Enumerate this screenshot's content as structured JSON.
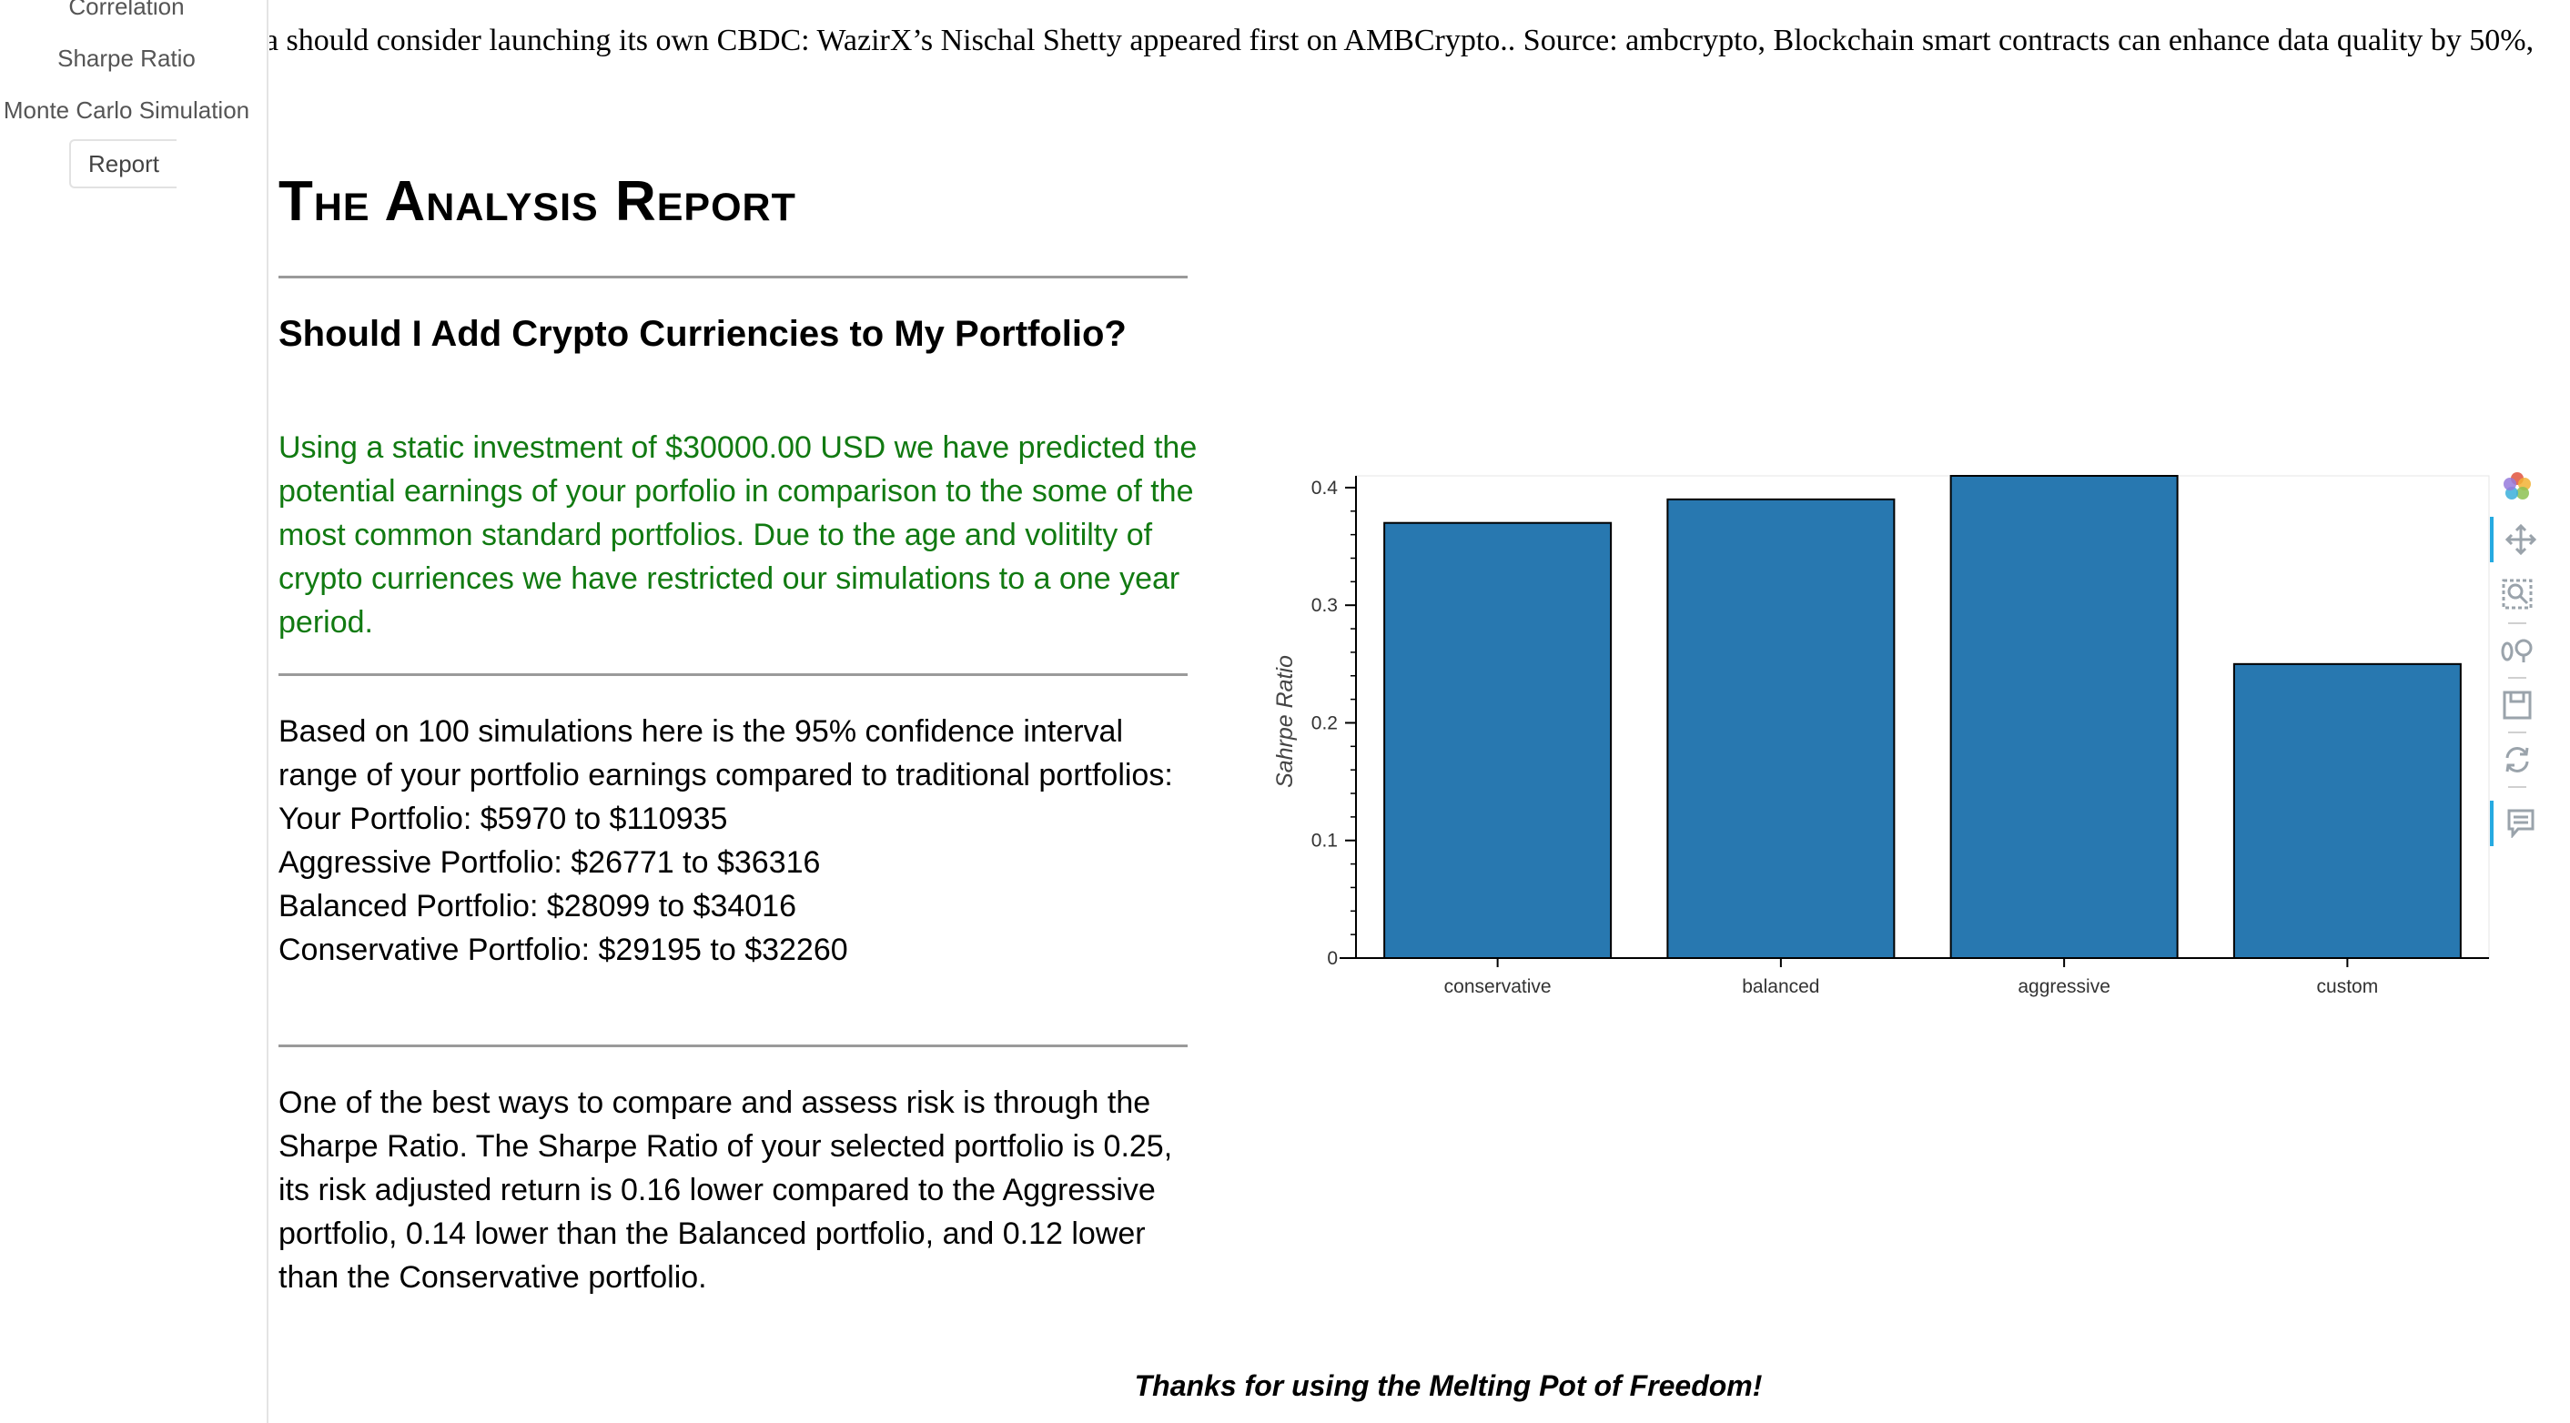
{
  "sidebar": {
    "items": [
      {
        "label": "Correlation"
      },
      {
        "label": "Sharpe Ratio"
      },
      {
        "label": "Monte Carlo Simulation"
      },
      {
        "label": "Report"
      }
    ]
  },
  "ticker": {
    "text": "lia should consider launching its own CBDC: WazirX’s Nischal Shetty appeared first on AMBCrypto.. Source: ambcrypto,  Blockchain smart contracts can enhance data quality by 50%,"
  },
  "report": {
    "title": "The Analysis Report",
    "subtitle": "Should I Add Crypto Curriencies to My Portfolio?",
    "intro": "Using a static investment of $30000.00 USD we have predicted the potential earnings of your porfolio in comparison to the some of the most common standard portfolios. Due to the age and volitilty of crypto curriences we have restricted our simulations to a one year period.",
    "ci_intro": "Based on 100 simulations here is the 95% confidence interval range of your portfolio earnings compared to traditional portfolios:",
    "ci_lines": [
      "Your Portfolio: $5970 to $110935",
      "Aggressive Portfolio: $26771 to $36316",
      "Balanced Portfolio: $28099 to $34016",
      "Conservative Portfolio: $29195 to $32260"
    ],
    "sharpe_text": "One of the best ways to compare and assess risk is through the Sharpe Ratio. The Sharpe Ratio of your selected portfolio is 0.25, its risk adjusted return is 0.16 lower compared to the Aggressive portfolio, 0.14 lower than the Balanced portfolio, and 0.12 lower than the Conservative portfolio.",
    "thanks": "Thanks for using the Melting Pot of Freedom!",
    "intro_color": "#117a11"
  },
  "chart_data": {
    "type": "bar",
    "categories": [
      "conservative",
      "balanced",
      "aggressive",
      "custom"
    ],
    "values": [
      0.37,
      0.39,
      0.41,
      0.25
    ],
    "ylabel": "Sahrpe Ratio",
    "xlabel": "",
    "ylim": [
      0,
      0.41
    ],
    "yticks": [
      "0",
      "0.1",
      "0.2",
      "0.3",
      "0.4"
    ],
    "bar_color": "#2878b0",
    "grid": false
  },
  "toolbar": {
    "tools": [
      {
        "icon": "bokeh-logo-icon"
      },
      {
        "icon": "pan-icon"
      },
      {
        "icon": "box-zoom-icon"
      },
      {
        "icon": "wheel-zoom-icon"
      },
      {
        "icon": "save-icon"
      },
      {
        "icon": "reset-icon"
      },
      {
        "icon": "hover-icon"
      }
    ]
  }
}
